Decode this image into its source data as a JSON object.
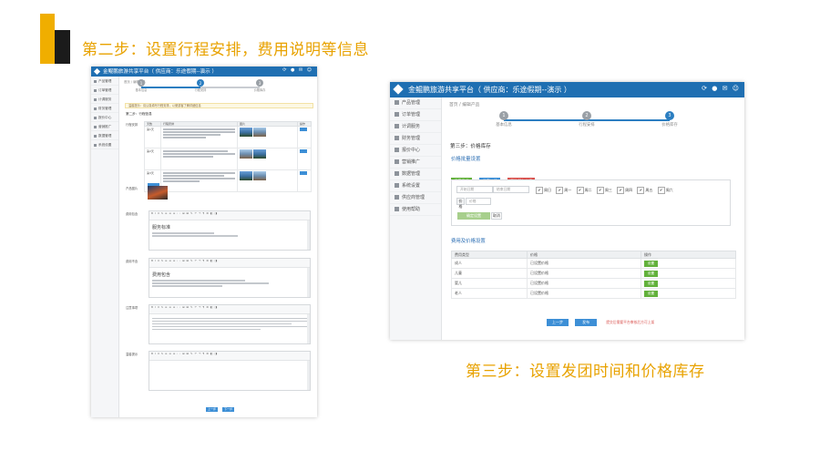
{
  "slide": {
    "step2_title": "第二步：设置行程安排，费用说明等信息",
    "step3_title": "第三步：设置发团时间和价格库存",
    "accent_color": "#f0ae00",
    "title_color": "#e8a200"
  },
  "app": {
    "title": "金鲲鹏旅游共享平台（ 供应商：乐途假期--演示 ）",
    "title_short": "金鲲鹏旅游共享平台（ 供应商：乐途假期--演示 ）",
    "header_color": "#1f6fb2",
    "icons": [
      "refresh-icon",
      "notification-icon",
      "message-icon",
      "user-icon"
    ]
  },
  "shotA": {
    "sidebar": [
      "产品管理",
      "订单管理",
      "计调服务",
      "财务管理",
      "报价中心",
      "营销推广",
      "数据管理",
      "系统设置",
      "供应商管理",
      "使用帮助"
    ],
    "breadcrumb": "首页 / 编辑产品",
    "steps": [
      {
        "num": "1",
        "label": "基本信息"
      },
      {
        "num": "2",
        "label": "行程安排"
      },
      {
        "num": "3",
        "label": "价格库存"
      }
    ],
    "notice": "温馨提示：请认真填写行程安排，以便游客了解详细信息",
    "subhead": "第二步：行程信息",
    "table_headers": [
      "天数",
      "行程安排",
      "图片",
      "操作"
    ],
    "rows": [
      {
        "day": "第1天"
      },
      {
        "day": "第2天"
      },
      {
        "day": "第3天"
      }
    ],
    "labels": [
      "行程安排",
      "产品图片",
      "费用包含",
      "费用不含",
      "注意事项",
      "温馨提示"
    ],
    "editor_texts": [
      "服务标准",
      "费用包含",
      "注意事项"
    ],
    "buttons": [
      "上一步",
      "下一步"
    ]
  },
  "shotB": {
    "sidebar": [
      "产品管理",
      "订单管理",
      "计调服务",
      "财务管理",
      "报价中心",
      "营销推广",
      "数据管理",
      "系统设置",
      "供应商管理",
      "使用帮助"
    ],
    "breadcrumb": "首页 / 编辑产品",
    "steps": [
      {
        "num": "1",
        "label": "基本信息"
      },
      {
        "num": "2",
        "label": "行程安排"
      },
      {
        "num": "3",
        "label": "价格库存"
      }
    ],
    "subtitle": "第三步：价格库存",
    "section1": "价格批量设置",
    "buttons": {
      "set_date": "设置日期",
      "set_price": "设置价格",
      "clear": "删除所有价格"
    },
    "inputs": {
      "start_date": "开始日期",
      "end_date": "结束日期",
      "price_placeholder": "价格"
    },
    "weekdays": [
      "周日",
      "周一",
      "周二",
      "周三",
      "周四",
      "周五",
      "周六"
    ],
    "price_label": "价格",
    "confirm": "确定设置",
    "cancel": "取消",
    "section2": "费用及价格设置",
    "table_headers": [
      "费用类型",
      "价格",
      "操作"
    ],
    "rows": [
      {
        "type": "成人",
        "price": "已设置价格",
        "action": "设置"
      },
      {
        "type": "儿童",
        "price": "已设置价格",
        "action": "设置"
      },
      {
        "type": "婴儿",
        "price": "已设置价格",
        "action": "设置"
      },
      {
        "type": "老人",
        "price": "已设置价格",
        "action": "设置"
      }
    ],
    "footer": {
      "prev": "上一步",
      "save": "发布",
      "note": "提交后需要平台审核后方可上架"
    }
  }
}
